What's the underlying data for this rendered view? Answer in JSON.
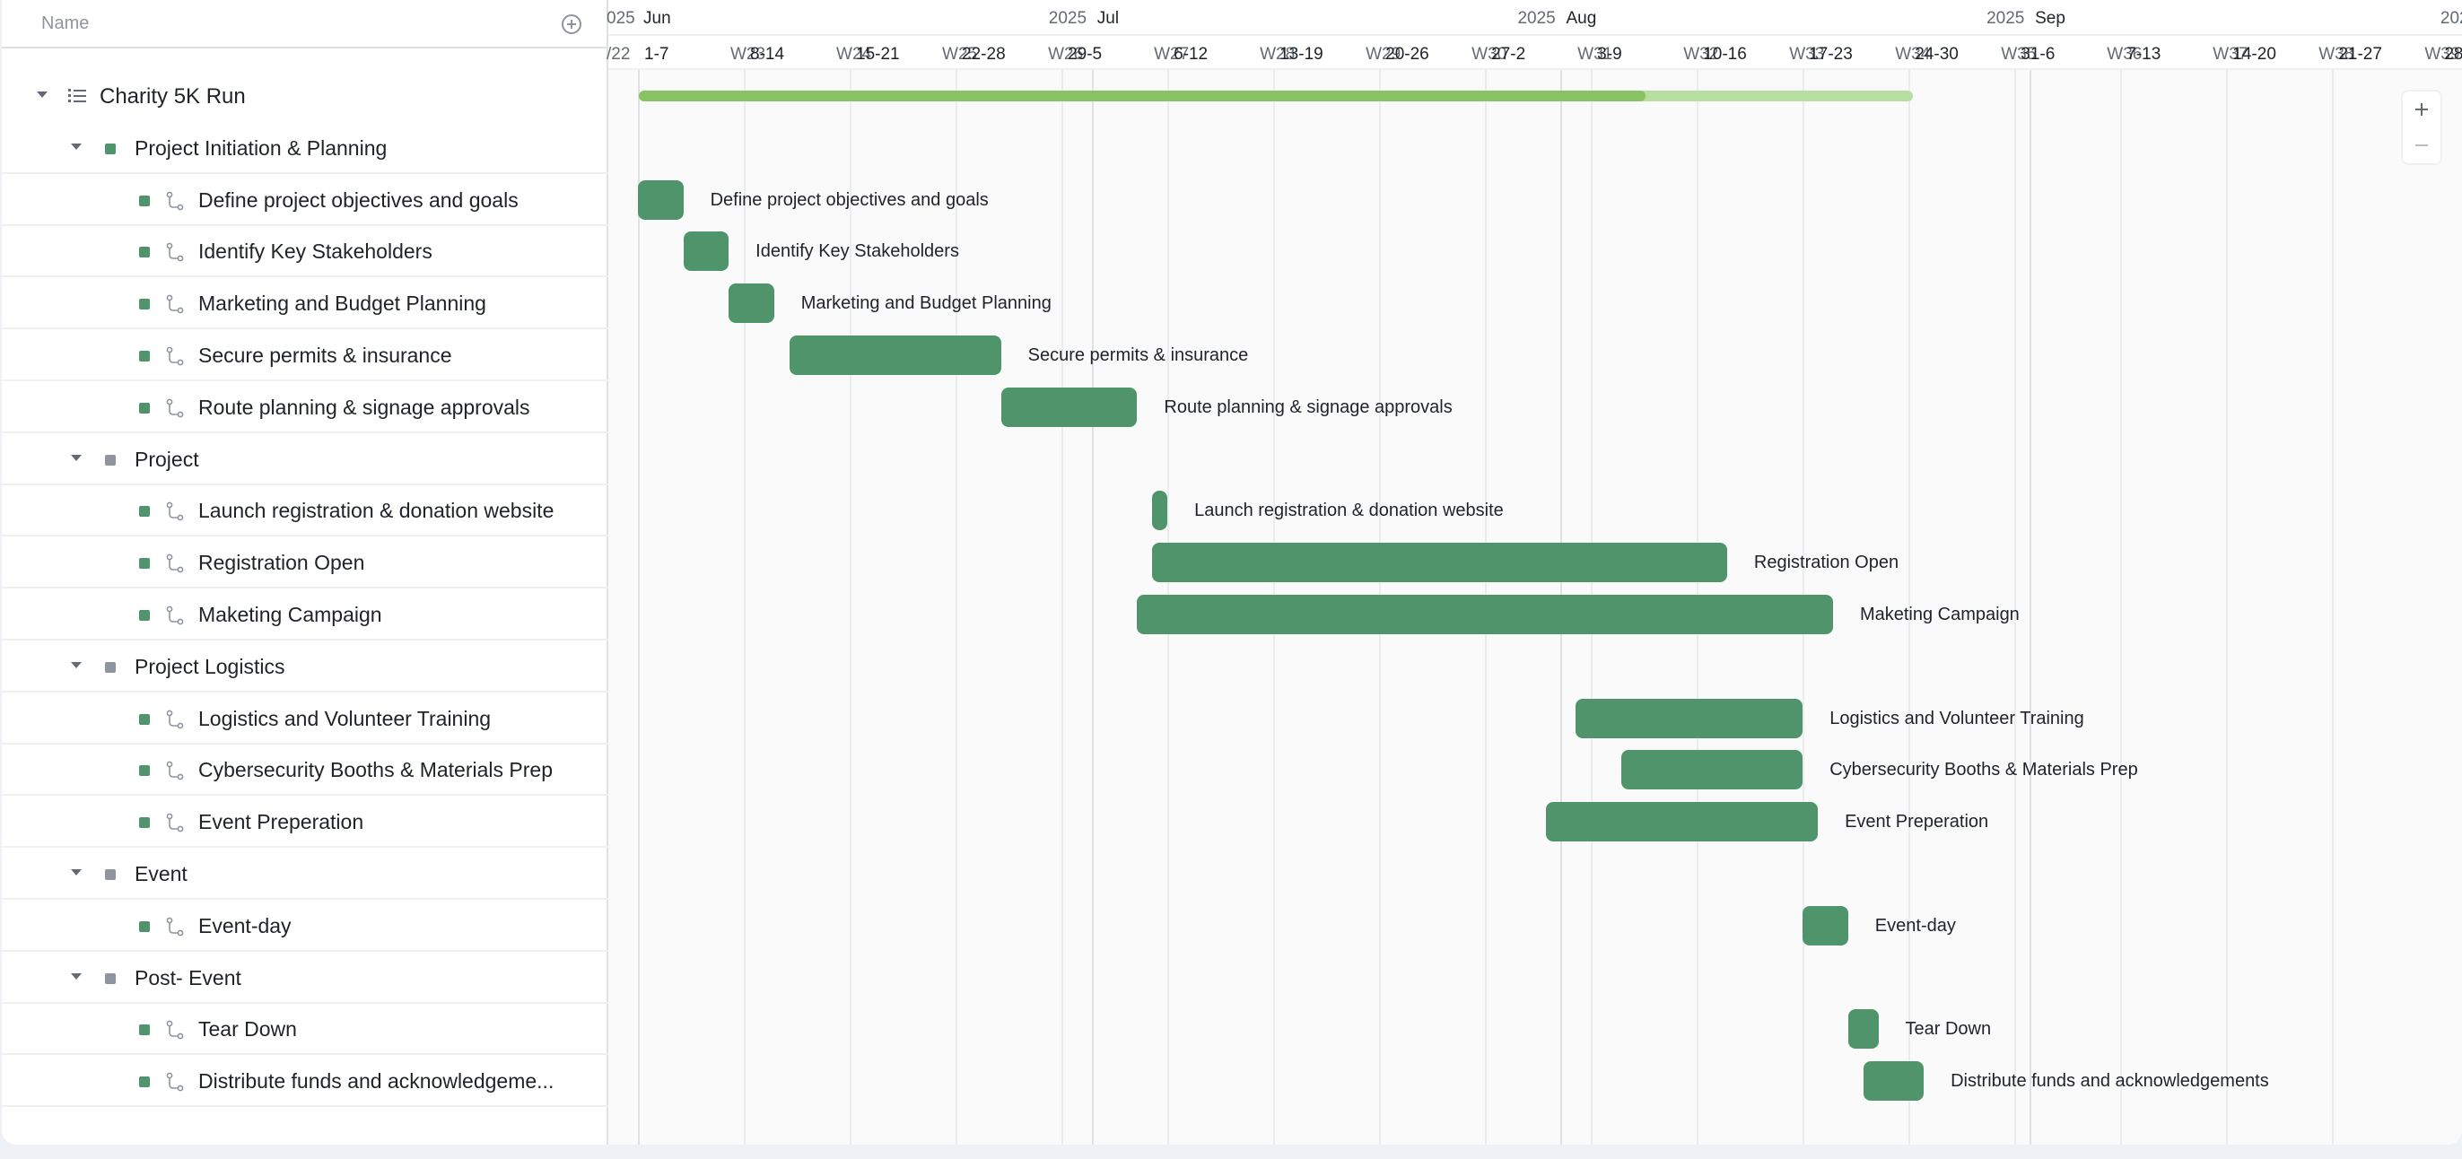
{
  "header": {
    "name_column_label": "Name"
  },
  "tasks": [
    {
      "label": "Charity 5K Run",
      "level": 0,
      "kind": "root"
    },
    {
      "label": "Project Initiation & Planning",
      "level": 1,
      "kind": "group",
      "color": "#4f946a"
    },
    {
      "label": "Define project objectives and goals",
      "level": 2,
      "kind": "task"
    },
    {
      "label": "Identify Key Stakeholders",
      "level": 2,
      "kind": "task"
    },
    {
      "label": "Marketing and Budget Planning",
      "level": 2,
      "kind": "task"
    },
    {
      "label": "Secure permits & insurance",
      "level": 2,
      "kind": "task"
    },
    {
      "label": "Route planning & signage approvals",
      "level": 2,
      "kind": "task"
    },
    {
      "label": "Project",
      "level": 1,
      "kind": "group",
      "color": "#8f959e"
    },
    {
      "label": "Launch registration & donation website",
      "level": 2,
      "kind": "task"
    },
    {
      "label": "Registration Open",
      "level": 2,
      "kind": "task"
    },
    {
      "label": "Maketing Campaign",
      "level": 2,
      "kind": "task"
    },
    {
      "label": "Project Logistics",
      "level": 1,
      "kind": "group",
      "color": "#8f959e"
    },
    {
      "label": "Logistics and Volunteer Training",
      "level": 2,
      "kind": "task"
    },
    {
      "label": "Cybersecurity Booths & Materials Prep",
      "level": 2,
      "kind": "task"
    },
    {
      "label": "Event Preperation",
      "level": 2,
      "kind": "task"
    },
    {
      "label": "Event",
      "level": 1,
      "kind": "group",
      "color": "#8f959e"
    },
    {
      "label": "Event-day",
      "level": 2,
      "kind": "task"
    },
    {
      "label": "Post- Event",
      "level": 1,
      "kind": "group",
      "color": "#8f959e"
    },
    {
      "label": "Tear Down",
      "level": 2,
      "kind": "task"
    },
    {
      "label": "Distribute funds and acknowledgeme...",
      "level": 2,
      "kind": "task"
    }
  ],
  "timeline": {
    "months": [
      {
        "year": "2025",
        "month": "Jun"
      },
      {
        "year": "2025",
        "month": "Jul"
      },
      {
        "year": "2025",
        "month": "Aug"
      },
      {
        "year": "2025",
        "month": "Sep"
      }
    ],
    "leading_fragments": {
      "year": "025",
      "week": "/22"
    },
    "trailing_fragments": {
      "year": "202",
      "week": "28"
    },
    "weeks": [
      "1-7",
      "W23",
      "8-14",
      "W24",
      "15-21",
      "W25",
      "22-28",
      "W26",
      "29-5",
      "W27",
      "6-12",
      "W28",
      "13-19",
      "W29",
      "20-26",
      "W30",
      "27-2",
      "W31",
      "3-9",
      "W32",
      "10-16",
      "W33",
      "17-23",
      "W34",
      "24-30",
      "W35",
      "31-6",
      "W36",
      "7-13",
      "W37",
      "14-20",
      "W38",
      "21-27",
      "W39"
    ],
    "project_progress": 0.79,
    "bars": [
      {
        "label": "Define project objectives and goals",
        "row": 2,
        "start": "2025-06-01",
        "end": "2025-06-04"
      },
      {
        "label": "Identify Key Stakeholders",
        "row": 3,
        "start": "2025-06-04",
        "end": "2025-06-07"
      },
      {
        "label": "Marketing and Budget Planning",
        "row": 4,
        "start": "2025-06-07",
        "end": "2025-06-10"
      },
      {
        "label": "Secure permits & insurance",
        "row": 5,
        "start": "2025-06-11",
        "end": "2025-06-25"
      },
      {
        "label": "Route planning & signage approvals",
        "row": 6,
        "start": "2025-06-25",
        "end": "2025-07-04"
      },
      {
        "label": "Launch registration & donation website",
        "row": 8,
        "start": "2025-07-05",
        "end": "2025-07-06"
      },
      {
        "label": "Registration Open",
        "row": 9,
        "start": "2025-07-05",
        "end": "2025-08-12"
      },
      {
        "label": "Maketing Campaign",
        "row": 10,
        "start": "2025-07-04",
        "end": "2025-08-19"
      },
      {
        "label": "Logistics and Volunteer Training",
        "row": 12,
        "start": "2025-08-02",
        "end": "2025-08-17"
      },
      {
        "label": "Cybersecurity Booths & Materials Prep",
        "row": 13,
        "start": "2025-08-05",
        "end": "2025-08-17"
      },
      {
        "label": "Event Preperation",
        "row": 14,
        "start": "2025-07-31",
        "end": "2025-08-18"
      },
      {
        "label": "Event-day",
        "row": 16,
        "start": "2025-08-17",
        "end": "2025-08-20"
      },
      {
        "label": "Tear Down",
        "row": 18,
        "start": "2025-08-20",
        "end": "2025-08-22"
      },
      {
        "label": "Distribute funds and acknowledgements",
        "row": 19,
        "start": "2025-08-21",
        "end": "2025-08-25"
      }
    ]
  },
  "zoom": {
    "in_label": "+",
    "out_label": "−"
  }
}
